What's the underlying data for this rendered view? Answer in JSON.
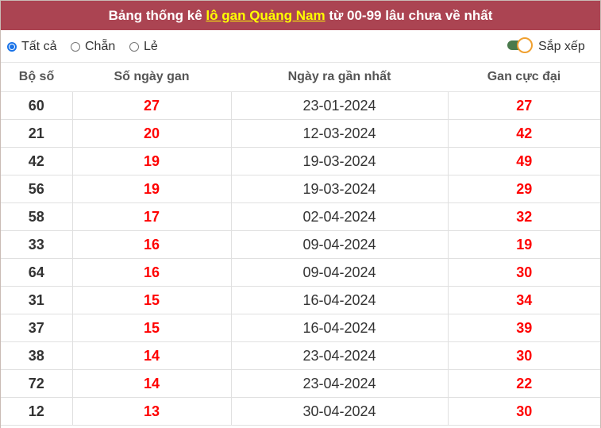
{
  "header": {
    "prefix": "Bảng thống kê ",
    "highlight": "lô gan Quảng Nam",
    "suffix": " từ 00-99 lâu chưa về nhất",
    "bg_color": "#ab4452",
    "highlight_color": "#ffff00"
  },
  "filters": {
    "options": [
      {
        "label": "Tất cả",
        "checked": true
      },
      {
        "label": "Chẵn",
        "checked": false
      },
      {
        "label": "Lẻ",
        "checked": false
      }
    ],
    "sort_label": "Sắp xếp",
    "sort_on": true
  },
  "table": {
    "headers": [
      "Bộ số",
      "Số ngày gan",
      "Ngày ra gần nhất",
      "Gan cực đại"
    ],
    "rows": [
      [
        "60",
        "27",
        "23-01-2024",
        "27"
      ],
      [
        "21",
        "20",
        "12-03-2024",
        "42"
      ],
      [
        "42",
        "19",
        "19-03-2024",
        "49"
      ],
      [
        "56",
        "19",
        "19-03-2024",
        "29"
      ],
      [
        "58",
        "17",
        "02-04-2024",
        "32"
      ],
      [
        "33",
        "16",
        "09-04-2024",
        "19"
      ],
      [
        "64",
        "16",
        "09-04-2024",
        "30"
      ],
      [
        "31",
        "15",
        "16-04-2024",
        "34"
      ],
      [
        "37",
        "15",
        "16-04-2024",
        "39"
      ],
      [
        "38",
        "14",
        "23-04-2024",
        "30"
      ],
      [
        "72",
        "14",
        "23-04-2024",
        "22"
      ],
      [
        "12",
        "13",
        "30-04-2024",
        "30"
      ]
    ]
  }
}
